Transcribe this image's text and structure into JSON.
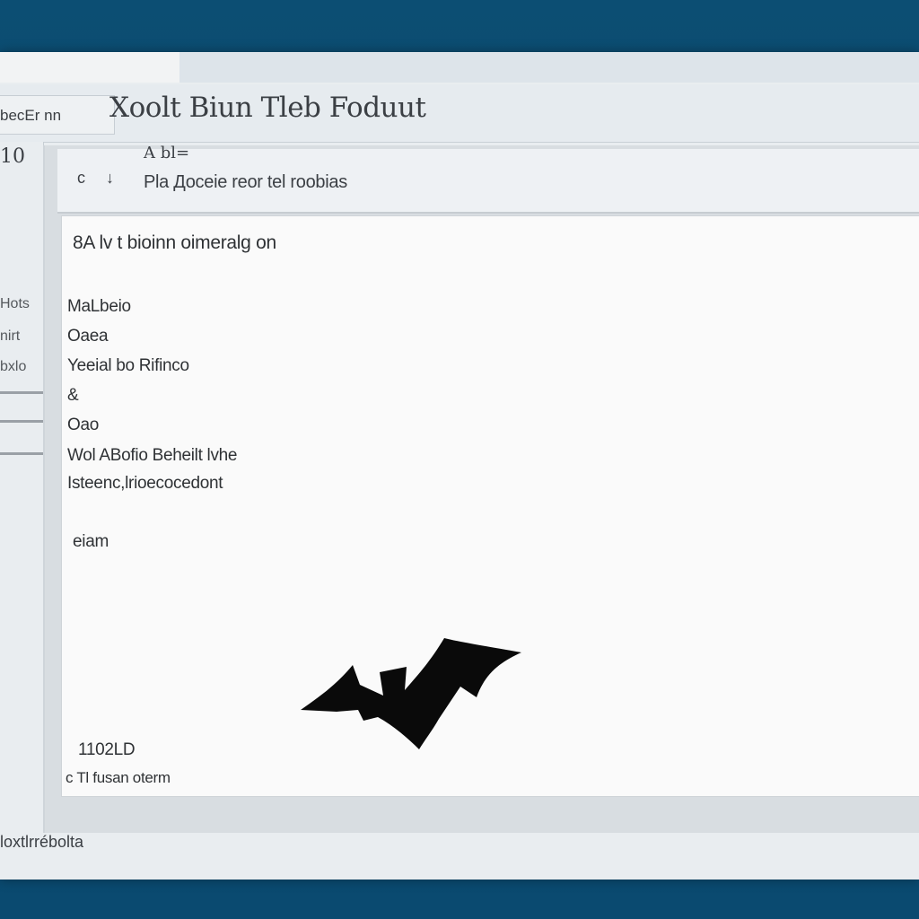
{
  "window": {
    "title": "Xoolt Biun Tleb Foduut"
  },
  "tab": {
    "label": "becEr nn"
  },
  "sidebar": {
    "top_label": "10",
    "items": [
      {
        "label": "Hots"
      },
      {
        "label": "nirt"
      },
      {
        "label": "bxlo"
      }
    ]
  },
  "toolbar": {
    "above_label": "A bl=",
    "back_icon_glyph": "c",
    "cursor_icon_glyph": "↓",
    "text": "Pla Доceie reor tel roobias"
  },
  "document": {
    "heading": "8A lv t bioinn oimeralg on",
    "lines": [
      "MaLbeio",
      "Oaea",
      "Yeeial bo Rifinco",
      "&",
      "Oao",
      "Wol ABofio Beheilt lvhe",
      "Isteenc,lrioecocedont",
      "eiam"
    ],
    "footer_code": "1102LD",
    "footer_line": "c Tl fusan oterm"
  },
  "status_bar": {
    "text": "loxtlrrébolta"
  },
  "colors": {
    "desktop": "#0b4a6e",
    "window": "#e9edf0",
    "page": "#fafafa",
    "text": "#2f3235"
  }
}
